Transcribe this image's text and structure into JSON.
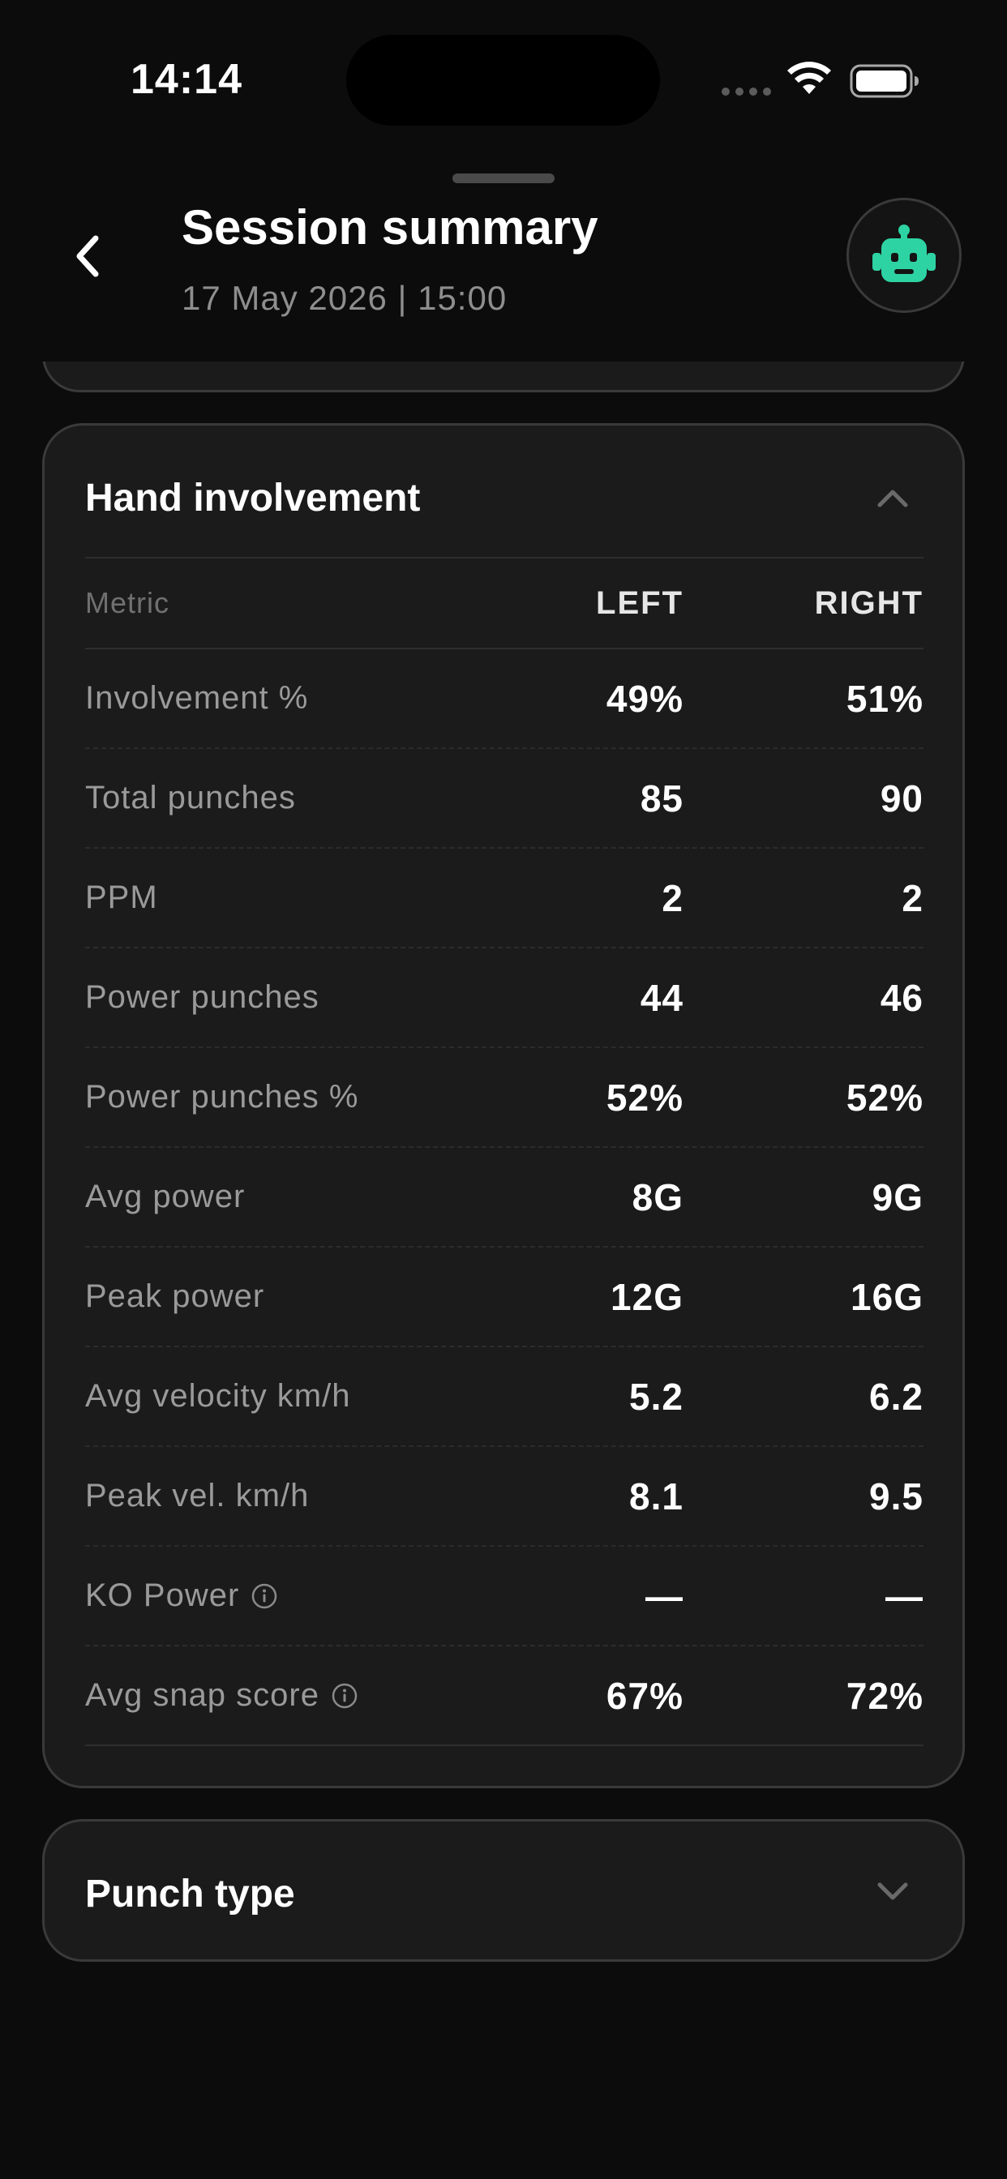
{
  "status_bar": {
    "time": "14:14"
  },
  "header": {
    "title": "Session summary",
    "subtitle": "17 May 2026 | 15:00",
    "back_icon": "chevron-left-icon",
    "assistant_icon": "robot-icon"
  },
  "colors": {
    "background": "#0c0c0c",
    "card": "#1b1b1b",
    "card_border": "#3a3a3a",
    "accent": "#2ed3a4",
    "muted_text": "#9a9a9a"
  },
  "hand_involvement": {
    "title": "Hand involvement",
    "expanded": true,
    "columns": {
      "metric": "Metric",
      "left": "LEFT",
      "right": "RIGHT"
    },
    "rows": [
      {
        "label": "Involvement %",
        "left": "49%",
        "right": "51%",
        "info": false
      },
      {
        "label": "Total punches",
        "left": "85",
        "right": "90",
        "info": false
      },
      {
        "label": "PPM",
        "left": "2",
        "right": "2",
        "info": false
      },
      {
        "label": "Power punches",
        "left": "44",
        "right": "46",
        "info": false
      },
      {
        "label": "Power punches %",
        "left": "52%",
        "right": "52%",
        "info": false
      },
      {
        "label": "Avg power",
        "left": "8G",
        "right": "9G",
        "info": false
      },
      {
        "label": "Peak power",
        "left": "12G",
        "right": "16G",
        "info": false
      },
      {
        "label": "Avg velocity km/h",
        "left": "5.2",
        "right": "6.2",
        "info": false
      },
      {
        "label": "Peak vel. km/h",
        "left": "8.1",
        "right": "9.5",
        "info": false
      },
      {
        "label": "KO Power",
        "left": "—",
        "right": "—",
        "info": true
      },
      {
        "label": "Avg snap score",
        "left": "67%",
        "right": "72%",
        "info": true
      }
    ]
  },
  "punch_type": {
    "title": "Punch type",
    "expanded": false
  }
}
